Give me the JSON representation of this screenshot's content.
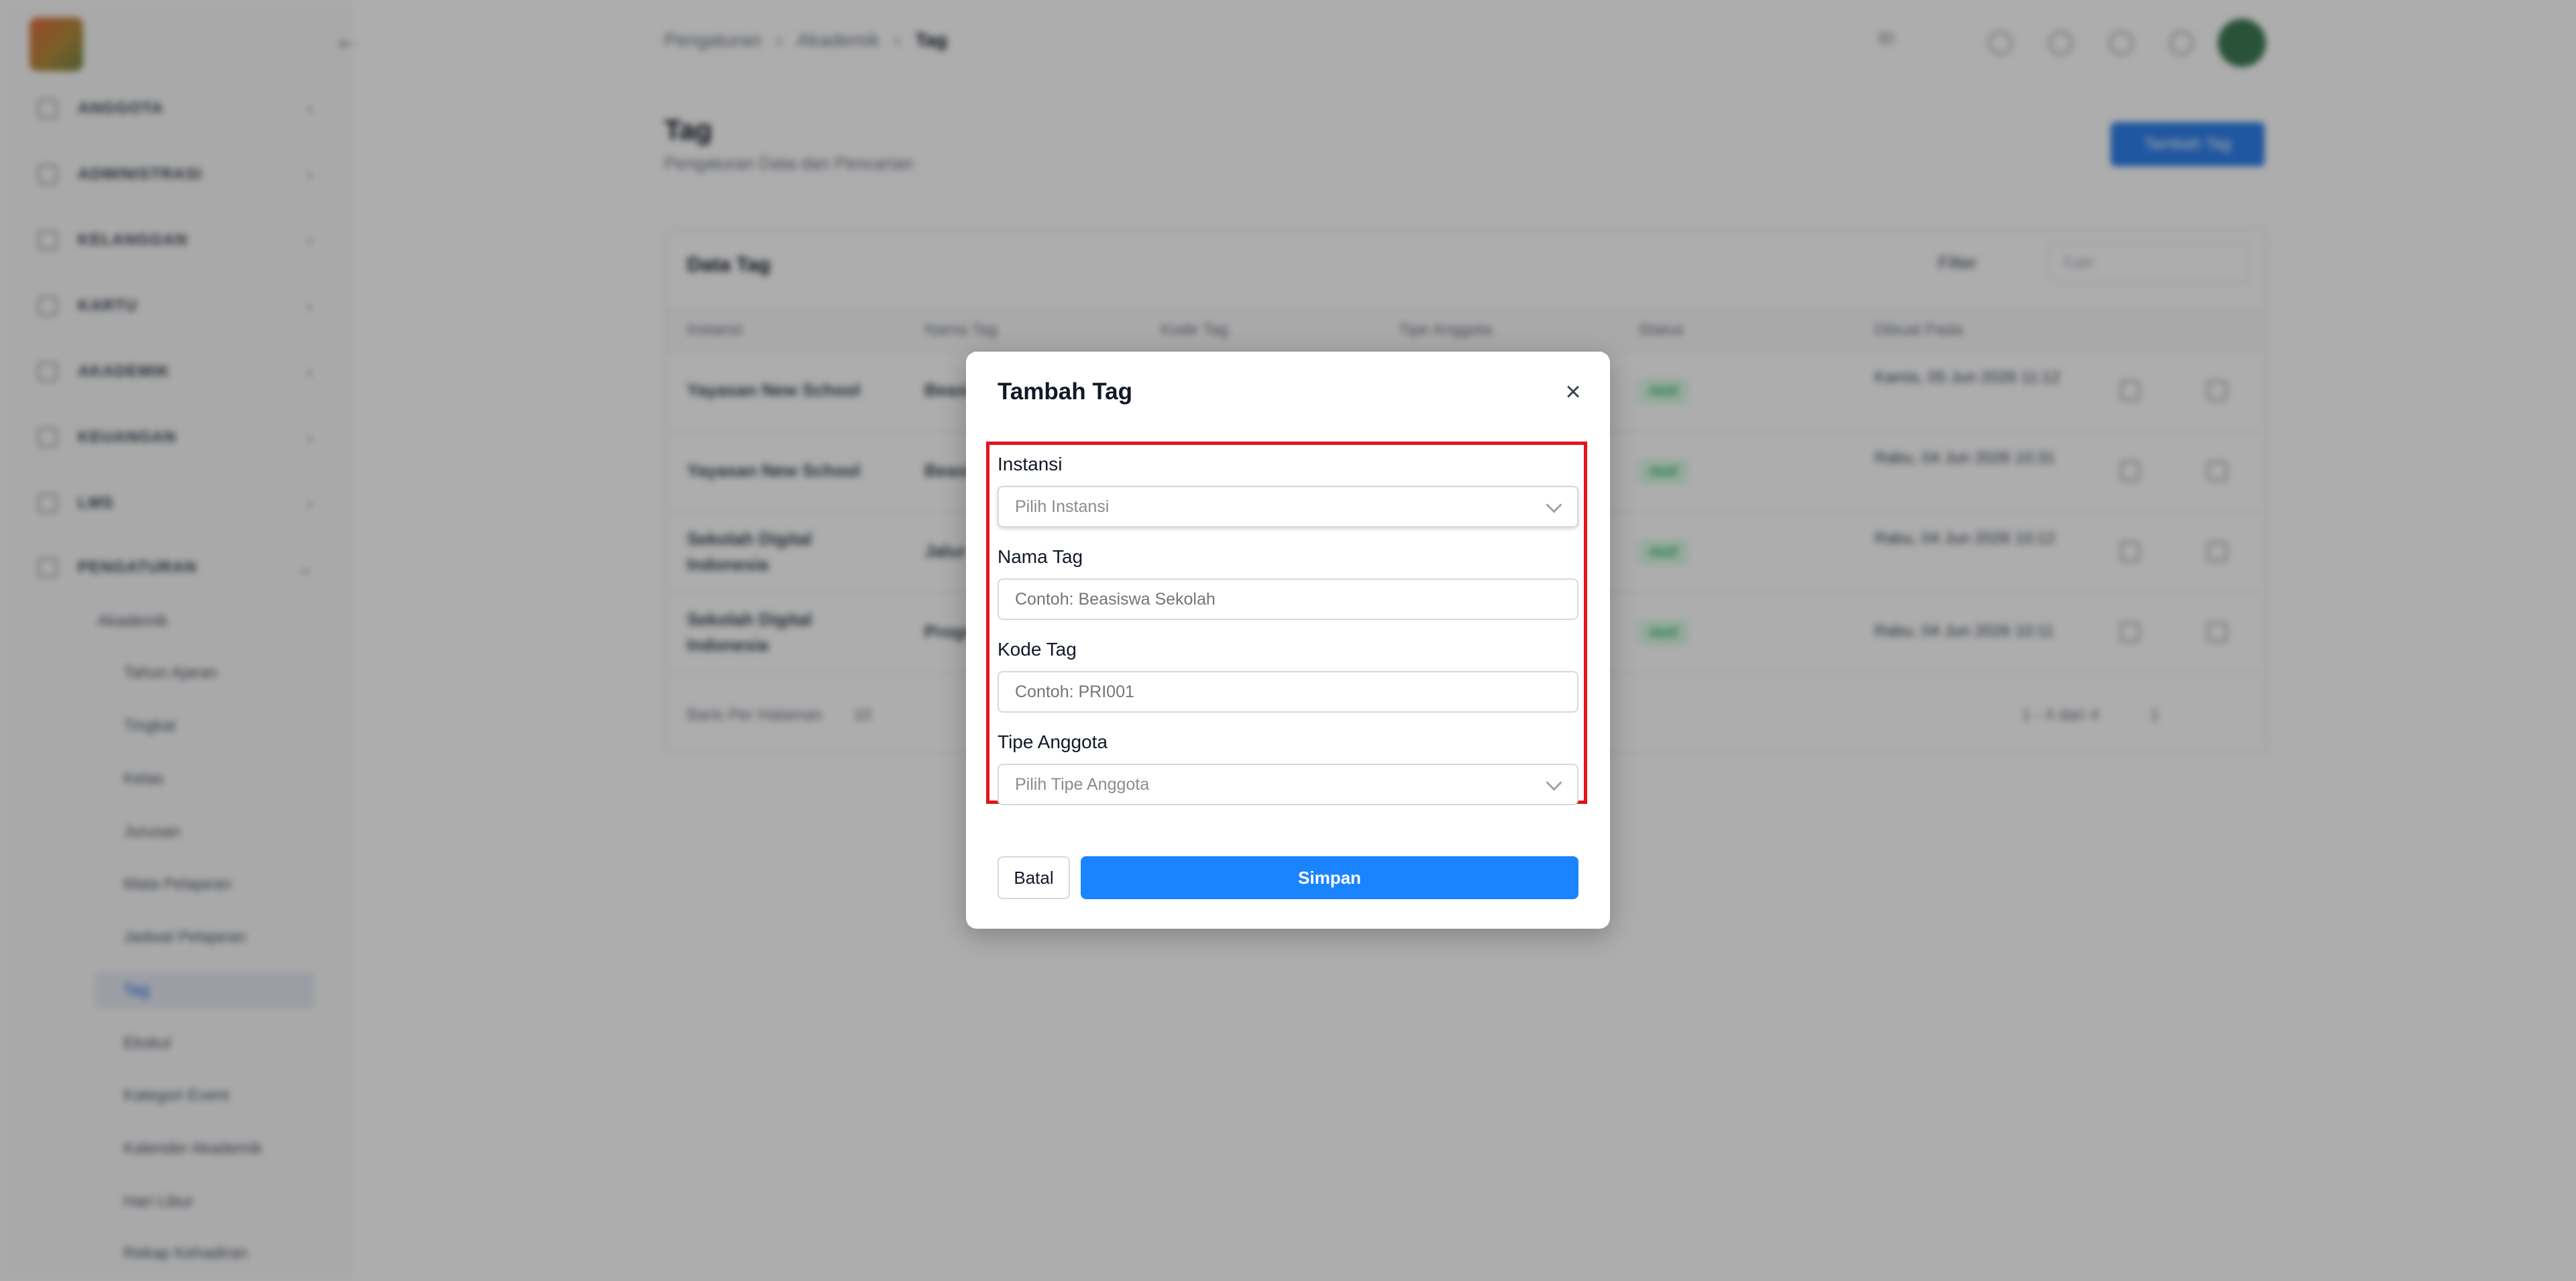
{
  "sidebar": {
    "menu": [
      "ANGGOTA",
      "ADMINISTRASI",
      "KELANGGAN",
      "KARTU",
      "AKADEMIK",
      "KEUANGAN",
      "LMS",
      "PENGATURAN"
    ],
    "submenu_group": "Akademik",
    "submenu": [
      "Tahun Ajaran",
      "Tingkat",
      "Kelas",
      "Jurusan",
      "Mata Pelajaran",
      "Jadwal Pelajaran",
      "Tag",
      "Ekskul",
      "Kategori Event",
      "Kalender Akademik",
      "Hari Libur",
      "Rekap Kehadiran"
    ],
    "active_item": "Tag"
  },
  "header": {
    "breadcrumb": [
      "Pengaturan",
      "Akademik",
      "Tag"
    ],
    "language": "ID"
  },
  "page": {
    "title": "Tag",
    "subtitle": "Pengaturan Data dan Pencarian",
    "add_button": "Tambah Tag"
  },
  "table": {
    "title": "Data Tag",
    "filter_label": "Filter",
    "search_placeholder": "Cari",
    "columns": [
      "Instansi",
      "Nama Tag",
      "Kode Tag",
      "Tipe Anggota",
      "Status",
      "Dibuat Pada"
    ],
    "rows": [
      {
        "instansi": "Yayasan New School",
        "nama": "Beasi",
        "status": "Aktif",
        "dibuat": "Kamis, 05 Jun 2026 11:12"
      },
      {
        "instansi": "Yayasan New School",
        "nama": "Beasi",
        "status": "Aktif",
        "dibuat": "Rabu, 04 Jun 2026 10:31"
      },
      {
        "instansi": "Sekolah Digital Indonesia",
        "nama": "Jalur",
        "status": "Aktif",
        "dibuat": "Rabu, 04 Jun 2026 10:12"
      },
      {
        "instansi": "Sekolah Digital Indonesia",
        "nama": "Progr",
        "status": "Aktif",
        "dibuat": "Rabu, 04 Jun 2026 10:11"
      }
    ],
    "per_page_label": "Baris Per Halaman",
    "per_page_value": "10",
    "pagination_info": "1 - 4 dari 4",
    "current_page": "1"
  },
  "modal": {
    "title": "Tambah Tag",
    "fields": [
      {
        "label": "Instansi",
        "placeholder": "Pilih Instansi",
        "type": "select"
      },
      {
        "label": "Nama Tag",
        "placeholder": "Contoh: Beasiswa Sekolah",
        "type": "text"
      },
      {
        "label": "Kode Tag",
        "placeholder": "Contoh: PRI001",
        "type": "text"
      },
      {
        "label": "Tipe Anggota",
        "placeholder": "Pilih Tipe Anggota",
        "type": "select"
      }
    ],
    "cancel_label": "Batal",
    "submit_label": "Simpan"
  },
  "colors": {
    "primary": "#1a84ff",
    "highlight_border": "#e3141b",
    "status_active": "#16a34a"
  }
}
